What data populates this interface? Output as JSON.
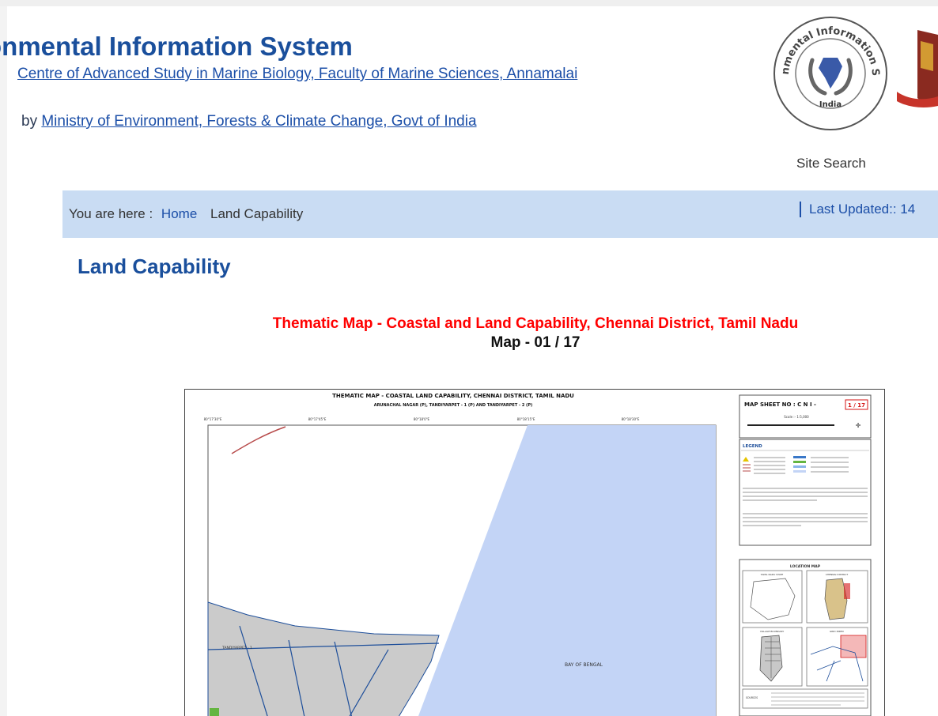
{
  "header": {
    "title": "onmental Information System",
    "centre_link": "Centre of Advanced Study in Marine Biology, Faculty of Marine Sciences, Annamalai",
    "by_prefix": "by",
    "ministry_link": "Ministry of Environment, Forests & Climate Change, Govt of India",
    "logo_text_top": "Environmental Information System",
    "logo_text_bottom": "India",
    "site_search": "Site Search"
  },
  "breadcrumb": {
    "prefix": "You are here :",
    "home": "Home",
    "current": "Land Capability",
    "last_updated": "Last Updated:: 14"
  },
  "content": {
    "page_title": "Land Capability",
    "map_title": "Thematic Map - Coastal and Land Capability, Chennai District, Tamil Nadu",
    "map_count": "Map - 01 / 17"
  },
  "map": {
    "title": "THEMATIC MAP - COASTAL LAND CAPABILITY, CHENNAI DISTRICT, TAMIL NADU",
    "subtitle": "ARUNACHAL NAGAR (P), TANDIYARPET - 1 (P) AND TANDIYARPET - 2 (P)",
    "sheet_label": "MAP SHEET NO : C N I -",
    "sheet_no": "1 / 17",
    "scale_label": "Scale :- 1:5,000",
    "legend_label": "LEGEND",
    "location_map_label": "LOCATION MAP",
    "tamil_nadu_state": "TAMIL NADU STATE",
    "chennai_district": "CHENNAI DISTRICT",
    "village_boundary": "VILLAGE BOUNDARY",
    "grid_index": "GRID INDEX",
    "sources_label": "SOURCES",
    "sea_label": "BAY OF BENGAL",
    "village_label": "TANDIYARPET - 1",
    "lon_ticks": [
      "80°17'30\"E",
      "80°17'45\"E",
      "80°18'0\"E",
      "80°18'15\"E",
      "80°18'30\"E"
    ],
    "colors": {
      "sea": "#c3d4f6",
      "land": "#cbcbcb",
      "road": "#b74a4a",
      "boundary": "#1d4e9a",
      "sheet_no": "#d41414"
    }
  }
}
